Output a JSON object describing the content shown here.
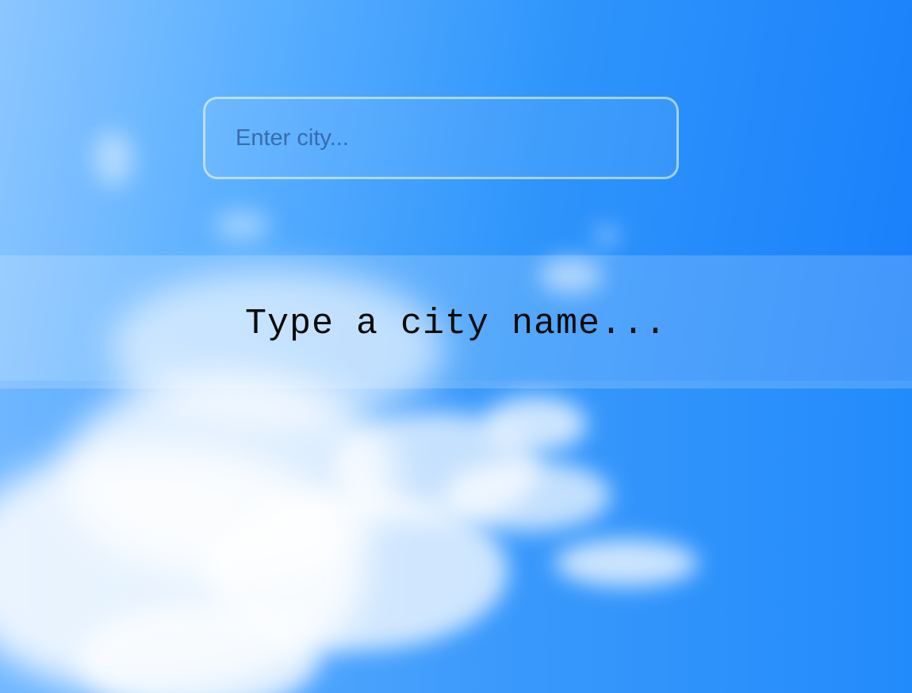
{
  "search": {
    "placeholder": "Enter city...",
    "value": ""
  },
  "message": {
    "text": "Type a city name..."
  },
  "colors": {
    "sky_light": "#8cc6ff",
    "sky_deep": "#167dfb",
    "band_overlay": "rgba(255,255,255,0.18)",
    "message_text": "#0b0b0b"
  },
  "background": {
    "icon": "sky-clouds-image"
  }
}
